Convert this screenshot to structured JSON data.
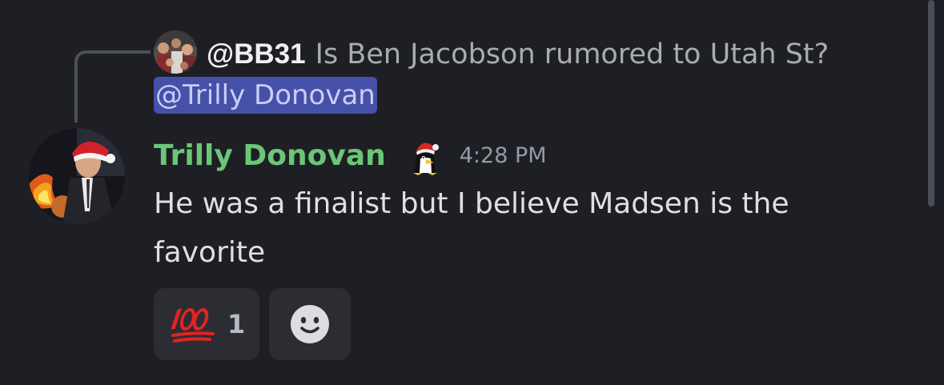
{
  "reply": {
    "author": "@BB31",
    "text": "Is Ben Jacobson rumored to Utah St?",
    "mention": "@Trilly Donovan",
    "avatar_icon": "user-avatar-icon"
  },
  "message": {
    "author": "Trilly Donovan",
    "author_color": "#6bc677",
    "timestamp": "4:28 PM",
    "text": "He was a finalist but I believe Madsen is the favorite",
    "avatar_icon": "user-avatar-icon",
    "badge_icon": "penguin-santa-hat-icon"
  },
  "reactions": [
    {
      "emoji": "hundred-points-icon",
      "count": "1"
    }
  ],
  "add_reaction_icon": "add-reaction-smiley-icon",
  "colors": {
    "background": "#1e1f24",
    "mention_bg": "#4551a8",
    "reaction_bg": "#2c2d33"
  }
}
